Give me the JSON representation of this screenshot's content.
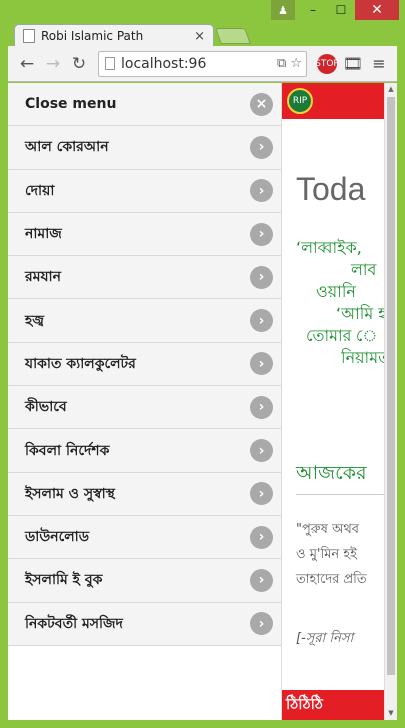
{
  "window": {
    "tab_title": "Robi Islamic Path",
    "tab_close": "×",
    "user_icon": "person",
    "minimize": "–",
    "maximize": "☐",
    "close": "✕"
  },
  "toolbar": {
    "back": "←",
    "forward": "→",
    "reload": "↻",
    "url": "localhost:96",
    "star": "☆",
    "page_action": "⧉",
    "stop_ext": "STOP",
    "film_ext": "🎞",
    "menu": "≡"
  },
  "menu": {
    "close_label": "Close menu",
    "close_icon": "×",
    "chevron": "›",
    "items": [
      {
        "label": "আল কোরআন"
      },
      {
        "label": "দোয়া"
      },
      {
        "label": "নামাজ"
      },
      {
        "label": "রমযান"
      },
      {
        "label": "হজ্ব"
      },
      {
        "label": "যাকাত ক্যালকুলেটর"
      },
      {
        "label": "কীভাবে"
      },
      {
        "label": "কিবলা নির্দেশক"
      },
      {
        "label": "ইসলাম ও সুস্বাস্থ"
      },
      {
        "label": "ডাউনলোড"
      },
      {
        "label": "ইসলামি ই বুক"
      },
      {
        "label": "নিকটবর্তী মসজিদ"
      }
    ]
  },
  "content": {
    "logo_text": "RIP",
    "today_heading": "Toda",
    "dua_lines": [
      "‘লাব্বাইক,",
      "লাব",
      "ওয়ানি",
      "‘আমি হ",
      "তোমার ে",
      "নিয়ামত"
    ],
    "sub_heading": "আজকের",
    "quote_lines": [
      "\"পুরুষ অথব",
      "ও মু'মিন হই",
      "তাহাদের প্রতি"
    ],
    "reference": "[-সূরা নিসা",
    "footer_text": "ঠিঠিঠি"
  }
}
